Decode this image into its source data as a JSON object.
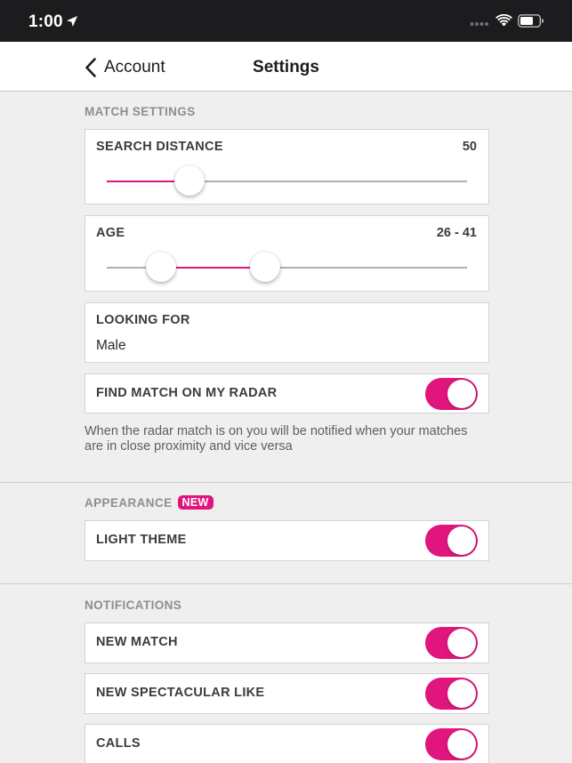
{
  "status_bar": {
    "time": "1:00"
  },
  "nav": {
    "back_label": "Account",
    "title": "Settings"
  },
  "match_settings": {
    "header": "MATCH SETTINGS",
    "search_distance": {
      "label": "SEARCH DISTANCE",
      "value": "50",
      "level": 0.23
    },
    "age": {
      "label": "AGE",
      "value": "26 - 41",
      "range_start": 0.15,
      "range_end": 0.44
    },
    "looking_for": {
      "label": "LOOKING FOR",
      "value": "Male"
    },
    "radar": {
      "label": "FIND MATCH ON MY RADAR",
      "enabled": true
    },
    "radar_note": "When the radar match is on you will be notified when your matches are in close proximity and vice versa"
  },
  "appearance": {
    "header": "APPEARANCE",
    "badge": "NEW",
    "light_theme": {
      "label": "LIGHT THEME",
      "enabled": true
    }
  },
  "notifications": {
    "header": "NOTIFICATIONS",
    "items": [
      {
        "label": "NEW MATCH",
        "enabled": true
      },
      {
        "label": "NEW SPECTACULAR LIKE",
        "enabled": true
      },
      {
        "label": "CALLS",
        "enabled": true
      }
    ]
  },
  "colors": {
    "accent": "#e0157d",
    "background": "#efeff0",
    "status_bar": "#1c1c1e"
  },
  "icons": [
    "location-arrow-icon",
    "cellular-signal-icon",
    "wifi-icon",
    "battery-icon",
    "chevron-left-icon"
  ]
}
